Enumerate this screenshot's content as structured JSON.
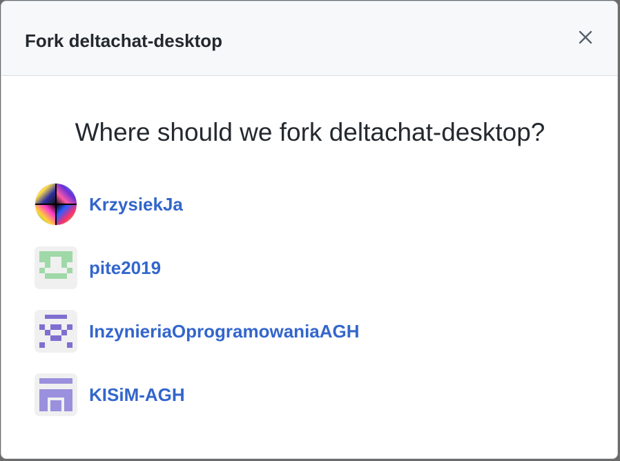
{
  "dialog": {
    "title": "Fork deltachat-desktop",
    "close_icon": "x-icon",
    "question": "Where should we fork deltachat-desktop?"
  },
  "owners": [
    {
      "name": "KrzysiekJa",
      "avatar": "rainbow-avatar",
      "avatar_color": "#multicolor"
    },
    {
      "name": "pite2019",
      "avatar": "identicon-avatar",
      "avatar_color": "#9fd9a8"
    },
    {
      "name": "InzynieriaOprogramowaniaAGH",
      "avatar": "identicon-avatar",
      "avatar_color": "#7f6fd1"
    },
    {
      "name": "KISiM-AGH",
      "avatar": "identicon-avatar",
      "avatar_color": "#9a90dd"
    }
  ],
  "colors": {
    "link": "#3366cc",
    "title_text": "#24292f",
    "header_bg": "#f6f8fa"
  }
}
